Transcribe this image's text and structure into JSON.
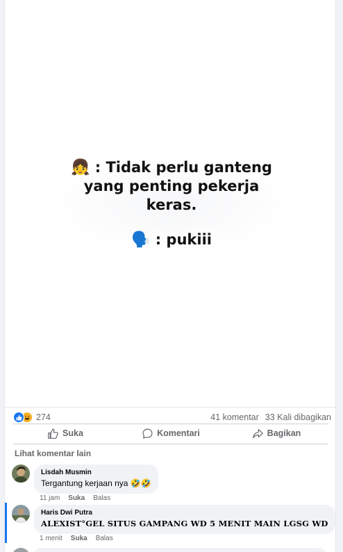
{
  "post": {
    "meme": {
      "line1_emoji": "👧",
      "line1": ": Tidak perlu ganteng",
      "line2": "yang penting pekerja",
      "line3": "keras.",
      "line4_emoji": "🗣️",
      "line4": ": pukiii"
    },
    "stats": {
      "reaction_count": "274",
      "comments": "41 komentar",
      "shares": "33 Kali dibagikan"
    },
    "actions": {
      "like": "Suka",
      "comment": "Komentari",
      "share": "Bagikan"
    },
    "more_comments": "Lihat komentar lain"
  },
  "comments": [
    {
      "name": "Lisdah Musmin",
      "text": "Tergantung kerjaan nya 🤣🤣",
      "time": "11 jam",
      "like": "Suka",
      "reply": "Balas"
    },
    {
      "name": "Haris Dwi Putra",
      "text": "ALEXIST°GEL SITUS GAMPANG WD 5 MENIT MAIN LGSG WD",
      "time": "1 menit",
      "like": "Suka",
      "reply": "Balas"
    }
  ],
  "colors": {
    "accent": "#1877f2",
    "muted_text": "#65676b",
    "bubble": "#f0f2f5"
  }
}
